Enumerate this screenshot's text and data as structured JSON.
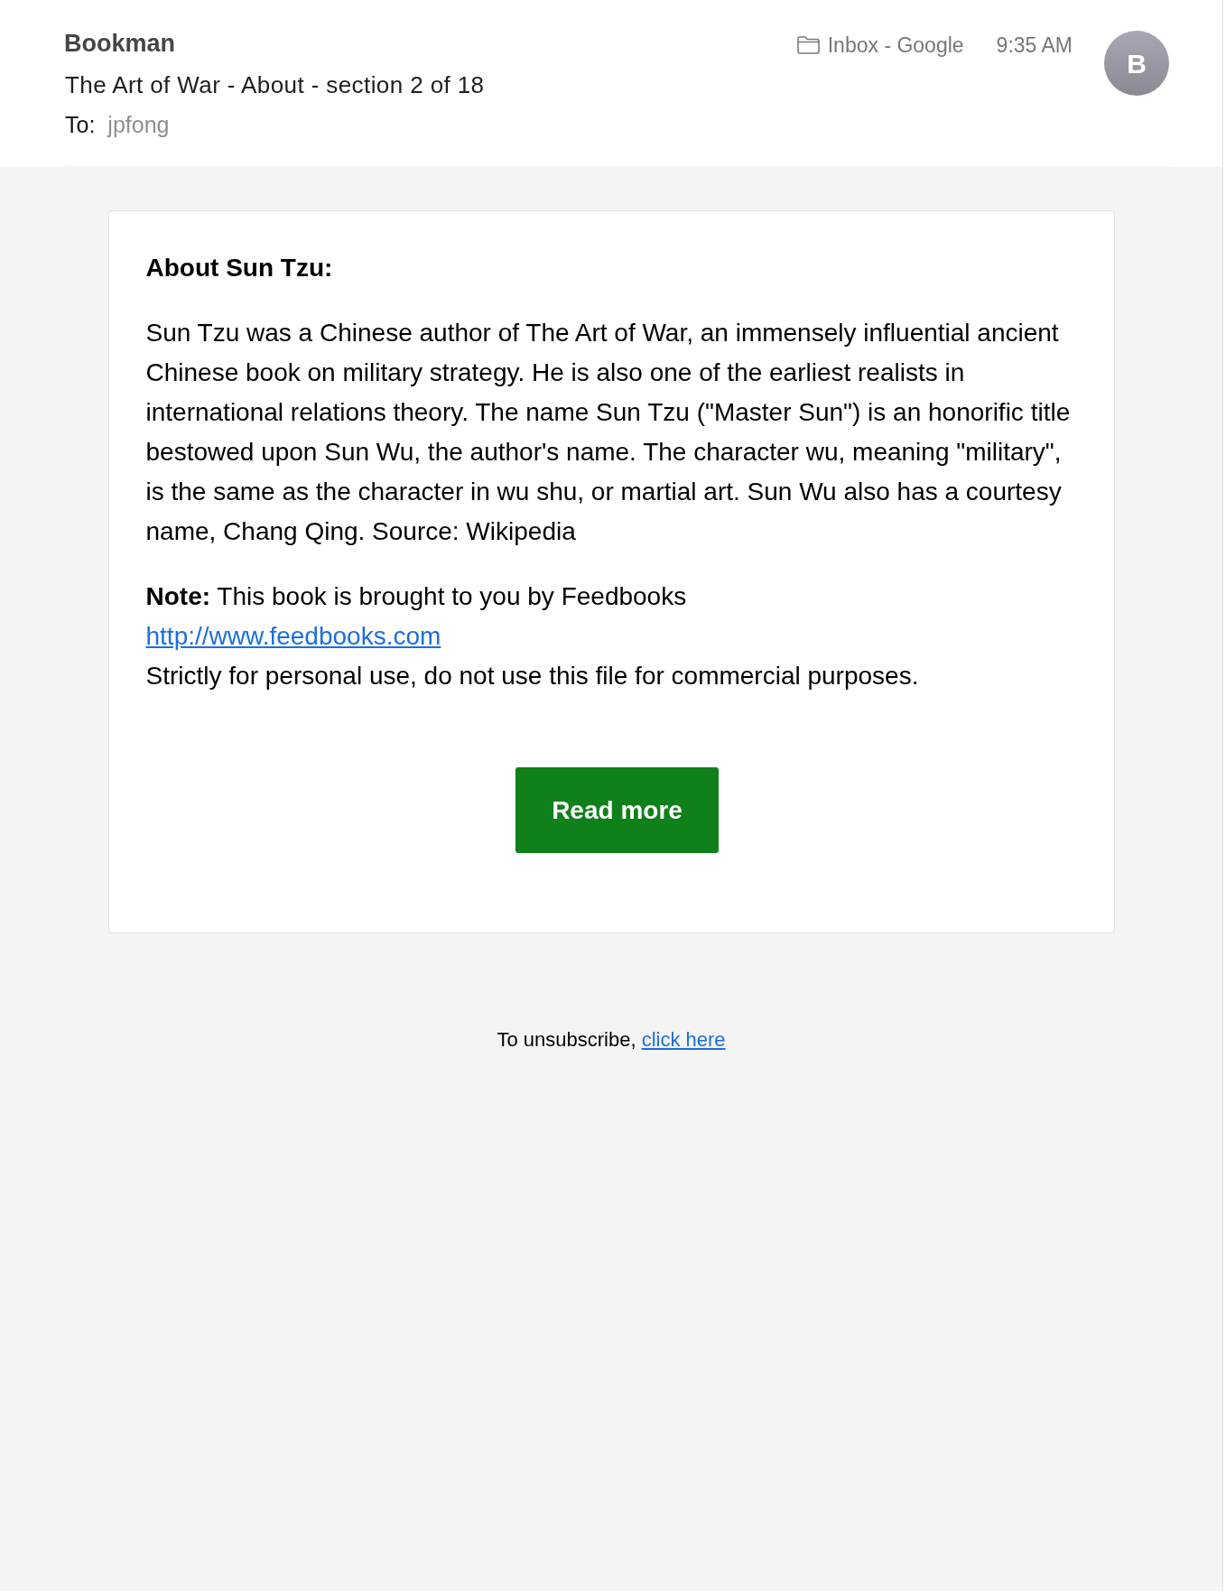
{
  "message": {
    "sender": "Bookman",
    "subject": "The Art of War - About - section 2 of 18",
    "to_label": "To:",
    "recipient": "jpfong",
    "mailbox": "Inbox - Google",
    "time": "9:35 AM",
    "avatar_initial": "B"
  },
  "body": {
    "heading": "About Sun Tzu:",
    "paragraph": "Sun Tzu was a Chinese author of The Art of War, an immensely influential ancient Chinese book on military strategy. He is also one of the earliest realists in international relations theory. The name Sun Tzu (\"Master Sun\") is an honorific title bestowed upon Sun Wu, the author's name. The character wu, meaning \"military\", is the same as the character in wu shu, or martial art. Sun Wu also has a courtesy name, Chang Qing. Source: Wikipedia",
    "note": "**Note:** This book is brought to you by Feedbooks",
    "link": "http://www.feedbooks.com",
    "disclaimer": "Strictly for personal use, do not use this file for commercial purposes.",
    "button": "Read more"
  },
  "footer": {
    "text": "To unsubscribe,",
    "link": "click here"
  }
}
